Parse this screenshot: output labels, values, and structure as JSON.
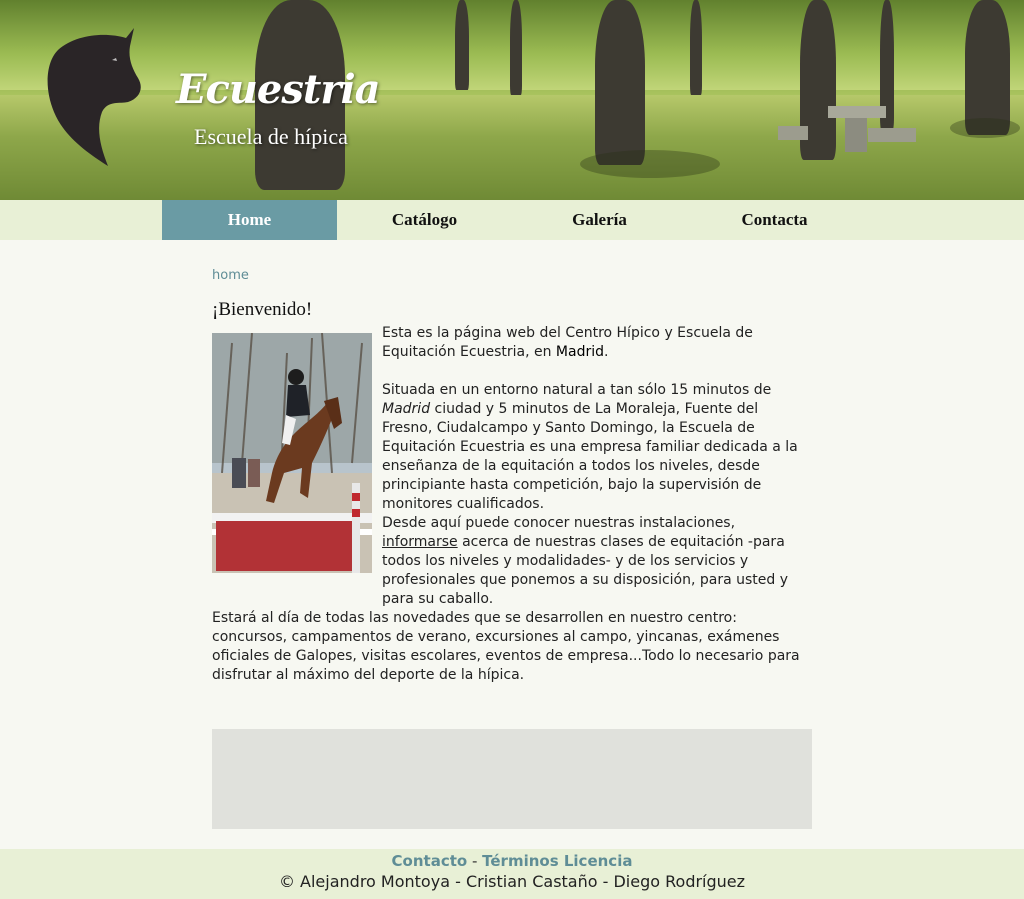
{
  "header": {
    "title": "Ecuestria",
    "subtitle": "Escuela de hípica",
    "logo_icon": "horse-head-icon"
  },
  "nav": {
    "items": [
      {
        "label": "Home",
        "active": true
      },
      {
        "label": "Catálogo",
        "active": false
      },
      {
        "label": "Galería",
        "active": false
      },
      {
        "label": "Contacta",
        "active": false
      }
    ],
    "active_color": "#6a9ba4"
  },
  "main": {
    "breadcrumb": "home",
    "title": "¡Bienvenido!",
    "p1_text": "Esta es la página web del Centro Hípico y Escuela de Equitación Ecuestria, en ",
    "p1_strong": "Madrid",
    "p1_end": ".",
    "p2_before": "Situada en un entorno natural a tan sólo 15 minutos de ",
    "p2_em": "Madrid",
    "p2_after": " ciudad y 5 minutos de La Moraleja, Fuente del Fresno, Ciudalcampo y Santo Domingo, la Escuela de Equitación Ecuestria es una empresa familiar dedicada a la enseñanza de la equitación a todos los niveles, desde principiante hasta competición, bajo la supervisión de monitores cualificados.",
    "p3_before": "Desde aquí puede conocer nuestras instalaciones, ",
    "p3_link": "informarse",
    "p3_after": " acerca de nuestras clases de equitación -para todos los niveles y modalidades- y de los servicios y profesionales que ponemos a su disposición, para usted y para su caballo.",
    "p4": "Estará al día de todas las novedades que se desarrollen en nuestro centro: concursos, campamentos de verano, excursiones al campo, yincanas, exámenes oficiales de Galopes, visitas escolares, eventos de empresa...Todo lo necesario para disfrutar al máximo del deporte de la hípica."
  },
  "footer": {
    "contact_link": "Contacto",
    "separator": " - ",
    "terms_link": "Términos Licencia",
    "credits": "© Alejandro Montoya - Cristian Castaño - Diego Rodríguez",
    "link_color": "#5f8d96"
  }
}
